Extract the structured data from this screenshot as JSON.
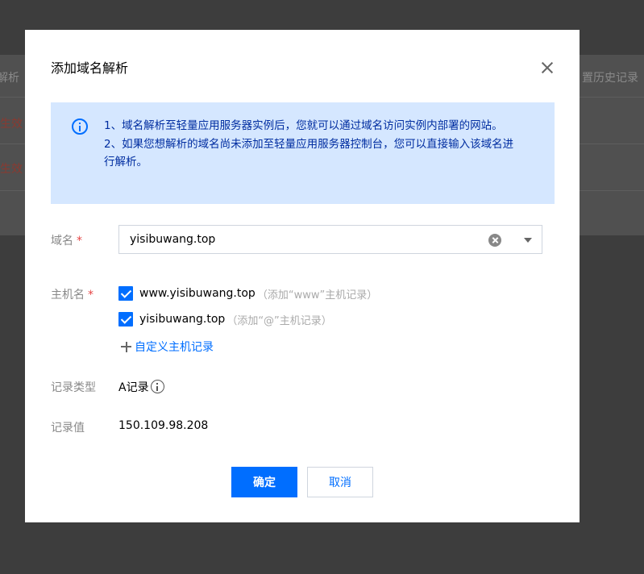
{
  "background": {
    "left_texts": [
      "解析",
      "未生效",
      "未生效"
    ],
    "right_text": "置历史记录"
  },
  "dialog": {
    "title": "添加域名解析",
    "close_icon": "close-icon",
    "notice": {
      "icon": "info-icon",
      "line1": "1、域名解析至轻量应用服务器实例后，您就可以通过域名访问实例内部署的网站。",
      "line2": "2、如果您想解析的域名尚未添加至轻量应用服务器控制台，您可以直接输入该域名进行解析。"
    },
    "domain": {
      "label": "域名",
      "required_mark": "*",
      "value": "yisibuwang.top"
    },
    "hostname": {
      "label": "主机名",
      "required_mark": "*",
      "options": [
        {
          "label": "www.yisibuwang.top",
          "hint": "（添加“www”主机记录）",
          "checked": true
        },
        {
          "label": "yisibuwang.top",
          "hint": "（添加“@”主机记录）",
          "checked": true
        }
      ],
      "add_custom": "自定义主机记录"
    },
    "record_type": {
      "label": "记录类型",
      "value": "A记录"
    },
    "record_value": {
      "label": "记录值",
      "value": "150.109.98.208"
    },
    "buttons": {
      "confirm": "确定",
      "cancel": "取消"
    }
  },
  "colors": {
    "primary": "#006eff",
    "notice_bg": "#d5e7ff",
    "required": "#e54545"
  }
}
